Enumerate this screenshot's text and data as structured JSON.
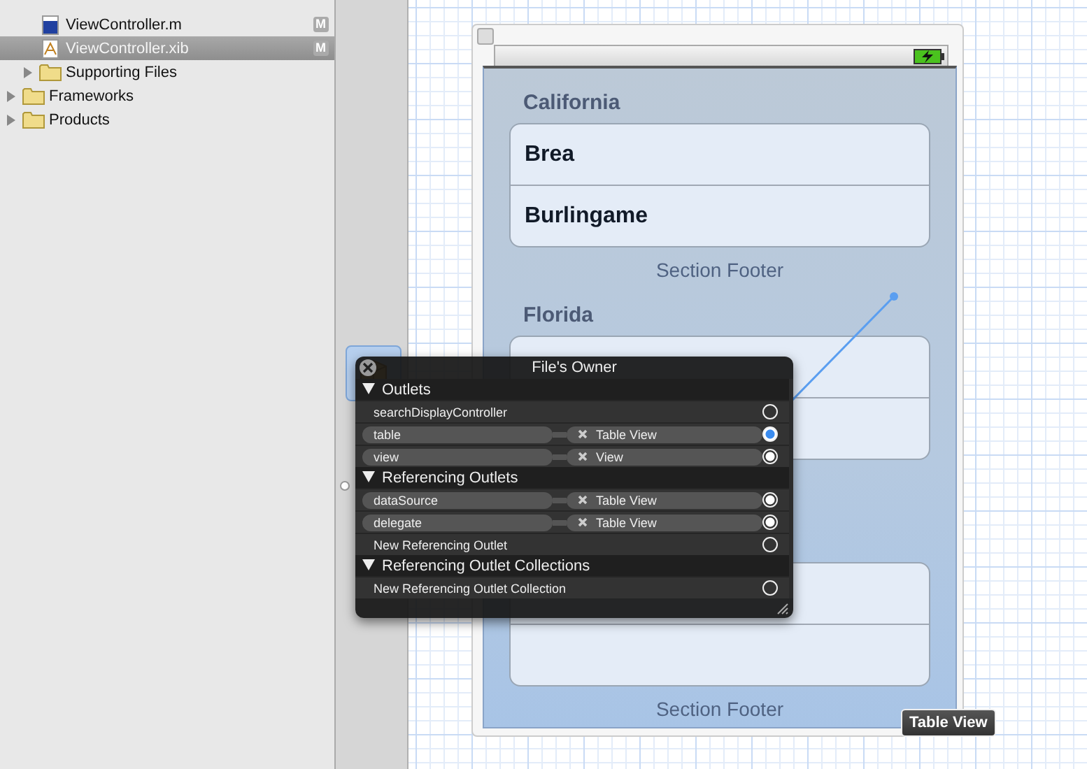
{
  "navigator": {
    "items": [
      {
        "children": [
          {
            "label": "ViewController.m",
            "kind": "source",
            "badge": "M",
            "selected": false
          },
          {
            "label": "ViewController.xib",
            "kind": "xib",
            "badge": "M",
            "selected": true
          },
          {
            "label": "Supporting Files",
            "kind": "folder",
            "expanded": false,
            "selected": false
          }
        ]
      },
      {
        "label": "Frameworks",
        "kind": "folder",
        "expanded": false,
        "selected": false
      },
      {
        "label": "Products",
        "kind": "folder",
        "expanded": false,
        "selected": false
      }
    ]
  },
  "table_view": {
    "sections": [
      {
        "header": "California",
        "rows": [
          "Brea",
          "Burlingame"
        ],
        "footer": "Section Footer"
      },
      {
        "header": "Florida",
        "rows": [
          "",
          ""
        ]
      },
      {
        "rows": [
          "",
          ""
        ],
        "footer": "Section Footer"
      }
    ]
  },
  "connections_popup": {
    "title": "File's Owner",
    "groups": [
      {
        "label": "Outlets",
        "expanded": true,
        "rows": [
          {
            "name": "searchDisplayController",
            "connected": false,
            "highlighted": false
          },
          {
            "name": "table",
            "target": "Table View",
            "connected": true,
            "highlighted": true
          },
          {
            "name": "view",
            "target": "View",
            "connected": true,
            "highlighted": false
          }
        ]
      },
      {
        "label": "Referencing Outlets",
        "expanded": true,
        "rows": [
          {
            "name": "dataSource",
            "target": "Table View",
            "connected": true,
            "highlighted": false
          },
          {
            "name": "delegate",
            "target": "Table View",
            "connected": true,
            "highlighted": false
          },
          {
            "name": "New Referencing Outlet",
            "connected": false,
            "highlighted": false
          }
        ]
      },
      {
        "label": "Referencing Outlet Collections",
        "expanded": true,
        "rows": [
          {
            "name": "New Referencing Outlet Collection",
            "connected": false,
            "highlighted": false
          }
        ]
      }
    ]
  },
  "tooltip": "Table View"
}
